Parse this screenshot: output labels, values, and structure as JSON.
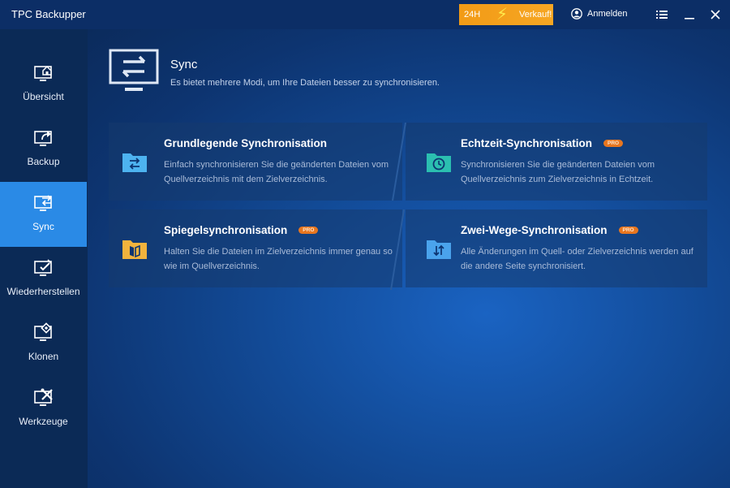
{
  "app": {
    "title": "TPC Backupper"
  },
  "promo": {
    "left_text": "24H",
    "right_text": "Verkauf!"
  },
  "header": {
    "login_label": "Anmelden"
  },
  "sidebar": {
    "items": [
      {
        "label": "Übersicht",
        "icon": "monitor-home-icon"
      },
      {
        "label": "Backup",
        "icon": "monitor-export-icon"
      },
      {
        "label": "Sync",
        "icon": "monitor-sync-icon",
        "active": true
      },
      {
        "label": "Wiederherstellen",
        "icon": "monitor-check-icon"
      },
      {
        "label": "Klonen",
        "icon": "monitor-clone-icon"
      },
      {
        "label": "Werkzeuge",
        "icon": "monitor-tools-icon"
      }
    ]
  },
  "page": {
    "title": "Sync",
    "subtitle": "Es bietet mehrere Modi, um Ihre Dateien besser zu synchronisieren."
  },
  "cards": [
    {
      "title": "Grundlegende Synchronisation",
      "desc": "Einfach synchronisieren Sie die geänderten Dateien vom Quellverzeichnis mit dem Zielverzeichnis.",
      "pro": "",
      "icon": "folder-sync-icon",
      "color": "#4db3f0"
    },
    {
      "title": "Echtzeit-Synchronisation",
      "desc": "Synchronisieren Sie die geänderten Dateien vom Quellverzeichnis zum Zielverzeichnis in Echtzeit.",
      "pro": "PRO",
      "icon": "folder-clock-icon",
      "color": "#2bbfb0"
    },
    {
      "title": "Spiegelsynchronisation",
      "desc": "Halten Sie die Dateien im Zielverzeichnis immer genau so wie im Quellverzeichnis.",
      "pro": "PRO",
      "icon": "folder-mirror-icon",
      "color": "#f2b33d"
    },
    {
      "title": "Zwei-Wege-Synchronisation",
      "desc": "Alle Änderungen im Quell- oder Zielverzeichnis werden auf die andere Seite synchronisiert.",
      "pro": "PRO",
      "icon": "folder-twoway-icon",
      "color": "#4aa3ec"
    }
  ],
  "colors": {
    "accent": "#2a8ae6",
    "promo": "#f29b16",
    "pro_badge": "#e8761f"
  }
}
